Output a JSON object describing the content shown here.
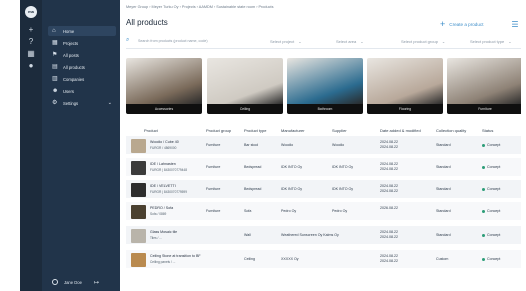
{
  "sidebar": {
    "strip_logo": "ma",
    "items": [
      {
        "label": "Home",
        "icon": "home-icon",
        "glyph": "⌂"
      },
      {
        "label": "Projects",
        "icon": "projects-icon",
        "glyph": "▦"
      },
      {
        "label": "All posts",
        "icon": "posts-icon",
        "glyph": "⚑"
      },
      {
        "label": "All products",
        "icon": "products-icon",
        "glyph": "▤"
      },
      {
        "label": "Companies",
        "icon": "companies-icon",
        "glyph": "▥"
      },
      {
        "label": "Users",
        "icon": "users-icon",
        "glyph": "☻"
      },
      {
        "label": "Settings",
        "icon": "settings-icon",
        "glyph": "⚙"
      }
    ],
    "user_name": "Jane Doe"
  },
  "header": {
    "breadcrumb": "Meyer Group › Meyer Turku Oy › Projects › AAMDM › Sustainable state room › Products",
    "title": "All products",
    "create_label": "Create a product"
  },
  "filters": {
    "search_placeholder": "Search from products (product name, code)",
    "selects": [
      "Select project",
      "Select area",
      "Select product group",
      "Select product type"
    ]
  },
  "cards": [
    {
      "label": "Accessories",
      "color": "#7a6a5a"
    },
    {
      "label": "Ceiling",
      "color": "#cfcac2"
    },
    {
      "label": "Bathroom",
      "color": "#2b6b8f"
    },
    {
      "label": "Flooring",
      "color": "#b8a89a"
    },
    {
      "label": "Furniture",
      "color": "#8e8276"
    }
  ],
  "table": {
    "columns": [
      "Product",
      "Product group",
      "Product type",
      "Manufacturer",
      "Supplier",
      "Date added & modified",
      "Collection quality",
      "Status"
    ],
    "rows": [
      {
        "name": "Woodio / Cube 40",
        "sku": "FURGR / 4869000",
        "group": "Furniture",
        "type": "Bar stool",
        "manufacturer": "Woodio",
        "supplier": "Woodio",
        "dates": [
          "2024.08.22",
          "2024.08.22"
        ],
        "quality": "Standard",
        "status": "Concept",
        "thumb": "#b9a88f"
      },
      {
        "name": "IDE / Lahnasten",
        "sku": "FURGR | 8430070779448",
        "group": "Furniture",
        "type": "Bedspread",
        "manufacturer": "IDK INTO Oy",
        "supplier": "IDK INTO Oy",
        "dates": [
          "2024.08.22",
          "2024.08.22"
        ],
        "quality": "Standard",
        "status": "Concept",
        "thumb": "#3b3b3b"
      },
      {
        "name": "IDE / VELVETTI",
        "sku": "FURGR | 8430070779599",
        "group": "Furniture",
        "type": "Bedspread",
        "manufacturer": "IDK INTO Oy",
        "supplier": "IDK INTO Oy",
        "dates": [
          "2024.08.22",
          "2024.08.22"
        ],
        "quality": "Standard",
        "status": "Concept",
        "thumb": "#2d2d2d"
      },
      {
        "name": "PEDRO / Sofa",
        "sku": "Sofa / 0869",
        "group": "Furniture",
        "type": "Sofa",
        "manufacturer": "Pedro Oy",
        "supplier": "Pedro Oy",
        "dates": [
          "2026.08.22",
          ""
        ],
        "quality": "Standard",
        "status": "Concept",
        "thumb": "#4a4030"
      },
      {
        "name": "Glass Mosaic tile",
        "sku": "Tiles / ...",
        "group": "",
        "type": "Wall",
        "manufacturer": "Weathered Sunscreen Oy Kalms Oy",
        "supplier": "",
        "dates": [
          "2024.08.22",
          "2024.08.22"
        ],
        "quality": "Standard",
        "status": "Concept",
        "thumb": "#b9b4aa"
      },
      {
        "name": "Ceiling Stone at transition to BF",
        "sku": "Ceiling panels / ...",
        "group": "",
        "type": "Ceiling",
        "manufacturer": "XXXXX Oy",
        "supplier": "",
        "dates": [
          "2024.08.22",
          "2024.08.22"
        ],
        "quality": "Custom",
        "status": "Concept",
        "thumb": "#b98a4f"
      }
    ]
  }
}
